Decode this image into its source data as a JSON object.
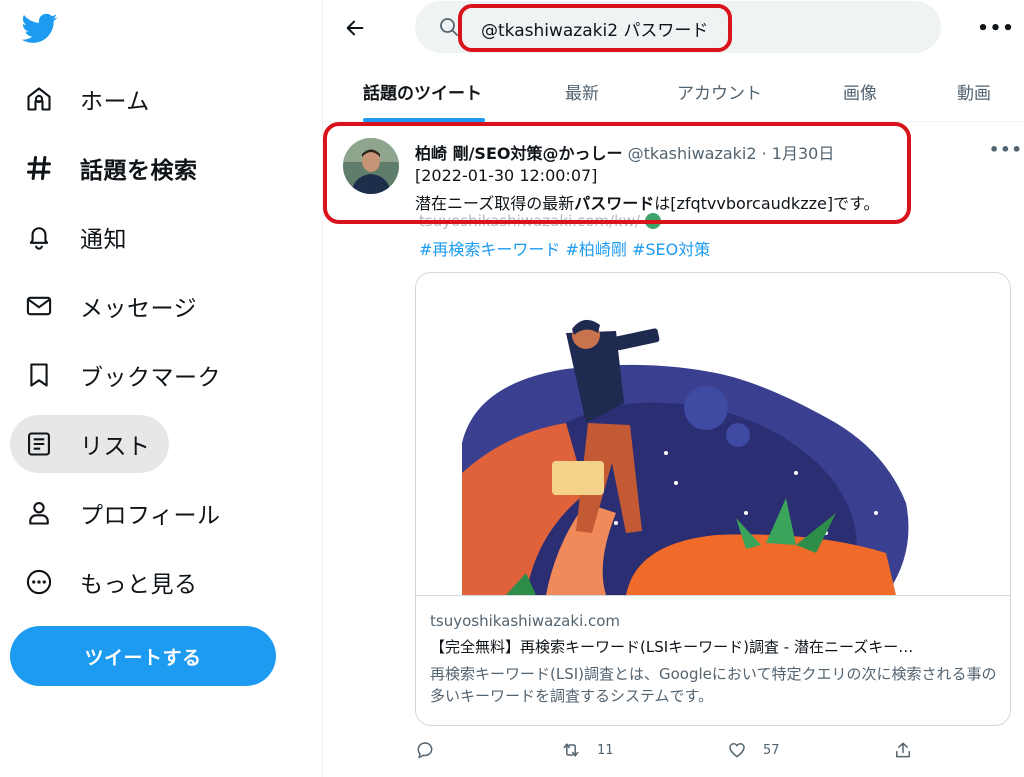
{
  "sidebar": {
    "items": [
      {
        "label": "ホーム",
        "icon": "home-icon"
      },
      {
        "label": "話題を検索",
        "icon": "hashtag-icon"
      },
      {
        "label": "通知",
        "icon": "bell-icon"
      },
      {
        "label": "メッセージ",
        "icon": "mail-icon"
      },
      {
        "label": "ブックマーク",
        "icon": "bookmark-icon"
      },
      {
        "label": "リスト",
        "icon": "list-icon"
      },
      {
        "label": "プロフィール",
        "icon": "person-icon"
      },
      {
        "label": "もっと見る",
        "icon": "more-circle-icon"
      }
    ],
    "tweet_button": "ツイートする"
  },
  "search": {
    "query": "@tkashiwazaki2 パスワード"
  },
  "tabs": [
    {
      "label": "話題のツイート",
      "active": true
    },
    {
      "label": "最新"
    },
    {
      "label": "アカウント"
    },
    {
      "label": "画像"
    },
    {
      "label": "動画"
    }
  ],
  "tweet": {
    "author": "柏崎 剛/SEO対策@かっしー",
    "handle": "@tkashiwazaki2 · 1月30日",
    "line1": "[2022-01-30 12:00:07]",
    "line2_before": "潜在ニーズ取得の最新",
    "line2_bold": "パスワード",
    "line2_after": "は[zfqtvvborcaudkzze]です。",
    "link": "tsuyoshikashiwazaki.com/kw/",
    "hashtags": "#再検索キーワード #柏崎剛 #SEO対策",
    "card": {
      "domain": "tsuyoshikashiwazaki.com",
      "title": "【完全無料】再検索キーワード(LSIキーワード)調査 - 潜在ニーズキー…",
      "description": "再検索キーワード(LSI)調査とは、Googleにおいて特定クエリの次に検索される事の多いキーワードを調査するシステムです。"
    },
    "retweets": "11",
    "likes": "57"
  },
  "colors": {
    "accent": "#1d9bf0",
    "highlight": "#d9131b"
  }
}
